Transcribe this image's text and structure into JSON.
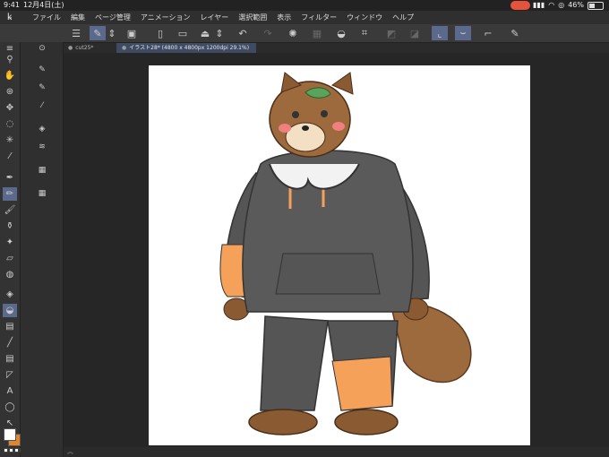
{
  "status": {
    "time": "9:41",
    "date": "12月4日(土)",
    "battery": "46%"
  },
  "menu": {
    "items": [
      "ファイル",
      "編集",
      "ページ管理",
      "アニメーション",
      "レイヤー",
      "選択範囲",
      "表示",
      "フィルター",
      "ウィンドウ",
      "ヘルプ"
    ]
  },
  "tabs": [
    {
      "label": "cut25*"
    },
    {
      "label": "イラスト28* (4800 x 4800px 1200dpi 29.1%)"
    }
  ],
  "bottom": {
    "chevron": "︽"
  },
  "colors": {
    "main": "#ffffff",
    "sub": "#e0872e",
    "accent": "#5b6a8c"
  }
}
